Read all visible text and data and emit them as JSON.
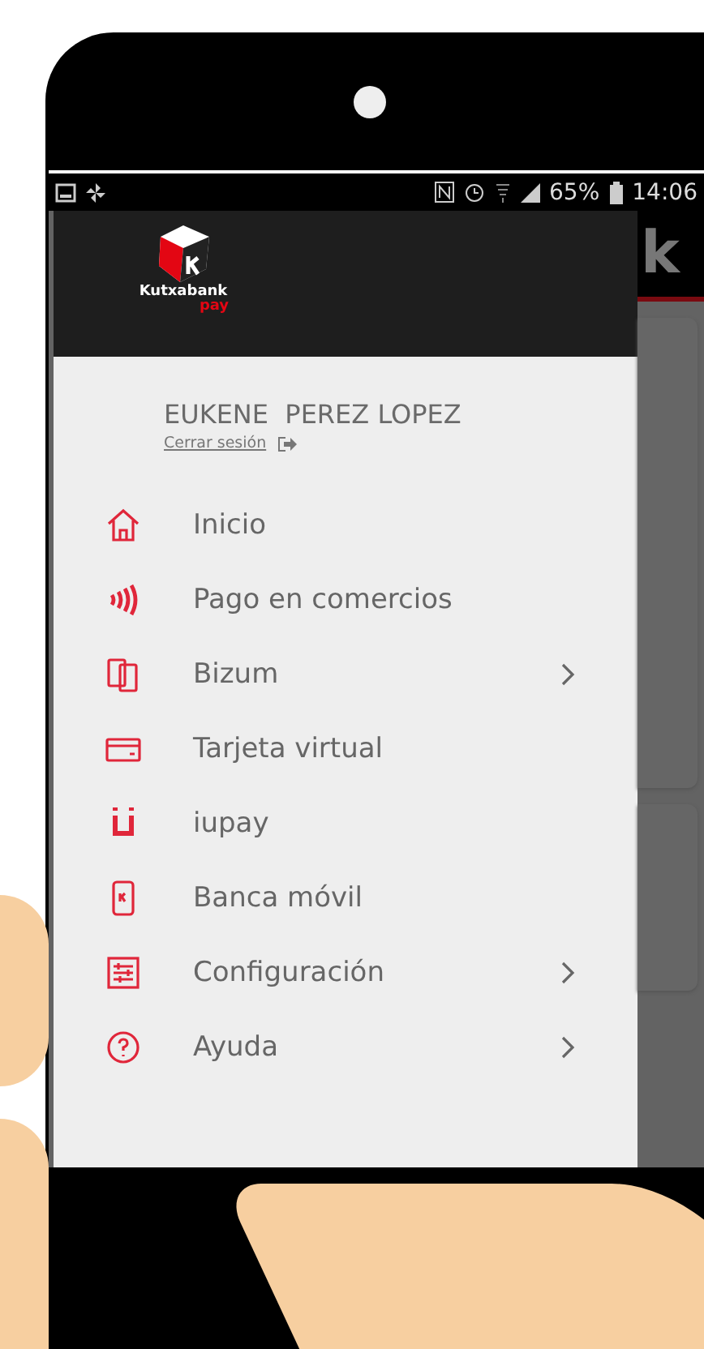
{
  "status_bar": {
    "battery": "65%",
    "time": "14:06"
  },
  "background_app": {
    "logo_letter": "k"
  },
  "drawer": {
    "brand": {
      "name": "Kutxabank",
      "sub": "pay"
    },
    "user": {
      "name": "EUKENE  PEREZ LOPEZ",
      "logout": "Cerrar sesión"
    },
    "menu": [
      {
        "label": "Inicio",
        "has_submenu": false
      },
      {
        "label": "Pago en comercios",
        "has_submenu": false
      },
      {
        "label": "Bizum",
        "has_submenu": true
      },
      {
        "label": "Tarjeta virtual",
        "has_submenu": false
      },
      {
        "label": "iupay",
        "has_submenu": false
      },
      {
        "label": "Banca móvil",
        "has_submenu": false
      },
      {
        "label": "Configuración",
        "has_submenu": true
      },
      {
        "label": "Ayuda",
        "has_submenu": true
      }
    ]
  }
}
